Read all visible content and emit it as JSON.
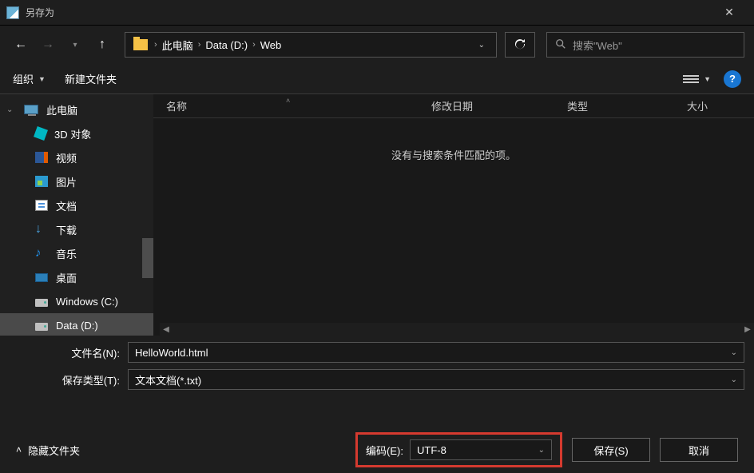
{
  "window": {
    "title": "另存为"
  },
  "nav": {
    "back": "←",
    "forward": "→",
    "up": "↑"
  },
  "breadcrumb": {
    "root": "此电脑",
    "drive": "Data (D:)",
    "folder": "Web"
  },
  "search": {
    "placeholder": "搜索\"Web\""
  },
  "toolbar": {
    "organize": "组织",
    "new_folder": "新建文件夹"
  },
  "sidebar": {
    "this_pc": "此电脑",
    "items": [
      {
        "label": "3D 对象",
        "icon": "3d"
      },
      {
        "label": "视频",
        "icon": "video"
      },
      {
        "label": "图片",
        "icon": "pics"
      },
      {
        "label": "文档",
        "icon": "docs"
      },
      {
        "label": "下载",
        "icon": "dl"
      },
      {
        "label": "音乐",
        "icon": "music"
      },
      {
        "label": "桌面",
        "icon": "desk"
      },
      {
        "label": "Windows (C:)",
        "icon": "drive"
      },
      {
        "label": "Data (D:)",
        "icon": "drive"
      }
    ]
  },
  "columns": {
    "name": "名称",
    "date": "修改日期",
    "type": "类型",
    "size": "大小"
  },
  "empty_msg": "没有与搜索条件匹配的项。",
  "form": {
    "filename_label": "文件名(N):",
    "filename_value": "HelloWorld.html",
    "filetype_label": "保存类型(T):",
    "filetype_value": "文本文档(*.txt)"
  },
  "footer": {
    "hide_folders": "隐藏文件夹",
    "encoding_label": "编码(E):",
    "encoding_value": "UTF-8",
    "save": "保存(S)",
    "cancel": "取消"
  }
}
